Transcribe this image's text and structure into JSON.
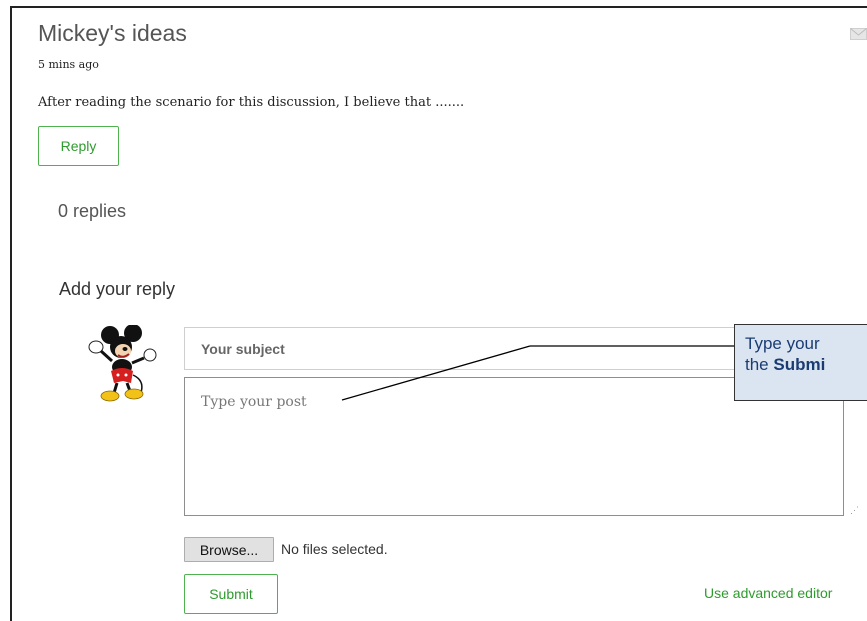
{
  "post": {
    "title": "Mickey's ideas",
    "time": "5 mins ago",
    "body": "After reading the scenario for this discussion, I believe that .......",
    "reply_label": "Reply"
  },
  "replies": {
    "count_label": "0 replies"
  },
  "reply_form": {
    "heading": "Add your reply",
    "subject_placeholder": "Your subject",
    "post_placeholder": "Type your post",
    "browse_label": "Browse...",
    "file_status": "No files selected.",
    "submit_label": "Submit",
    "advanced_editor_label": "Use advanced editor"
  },
  "callout": {
    "line1": "Type your",
    "line2_prefix": "the ",
    "line2_bold": "Submi"
  },
  "icons": {
    "mail": "mail-icon",
    "avatar": "mickey-avatar"
  },
  "colors": {
    "accent_green": "#2e9b2e",
    "callout_bg": "#dbe5f1",
    "callout_text": "#1b3c73"
  }
}
